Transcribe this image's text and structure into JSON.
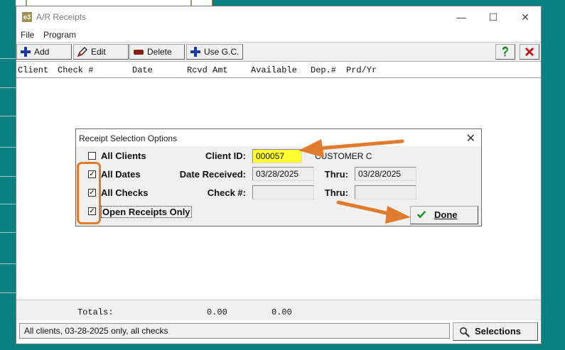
{
  "window": {
    "title": "A/R Receipts",
    "app_icon": "e3"
  },
  "menu": [
    "File",
    "Program"
  ],
  "toolbar": {
    "add": "Add",
    "edit": "Edit",
    "delete": "Delete",
    "use_gc": "Use G.C."
  },
  "columns": [
    "Client",
    "Check #",
    "Date",
    "Rcvd Amt",
    "Available",
    "Dep.#",
    "Prd/Yr"
  ],
  "totals": {
    "label": "Totals:",
    "rcvd": "0.00",
    "available": "0.00"
  },
  "status_text": "All clients, 03-28-2025 only, all checks",
  "selections_label": "Selections",
  "dialog": {
    "title": "Receipt Selection Options",
    "checkboxes": [
      {
        "label": "All Clients",
        "checked": false
      },
      {
        "label": "All Dates",
        "checked": true
      },
      {
        "label": "All Checks",
        "checked": true
      },
      {
        "label": "Open Receipts Only",
        "checked": true
      }
    ],
    "client_id_label": "Client ID:",
    "client_id_value": "000057",
    "client_name": "CUSTOMER C",
    "date_received_label": "Date Received:",
    "date_from": "03/28/2025",
    "thru_label": "Thru:",
    "date_thru": "03/28/2025",
    "check_label": "Check #:",
    "check_from": "",
    "check_thru": "",
    "done_label": "Done"
  },
  "colors": {
    "background": "#0b8080",
    "annotation": "#e07b2e",
    "highlight_field": "#ffff33"
  }
}
